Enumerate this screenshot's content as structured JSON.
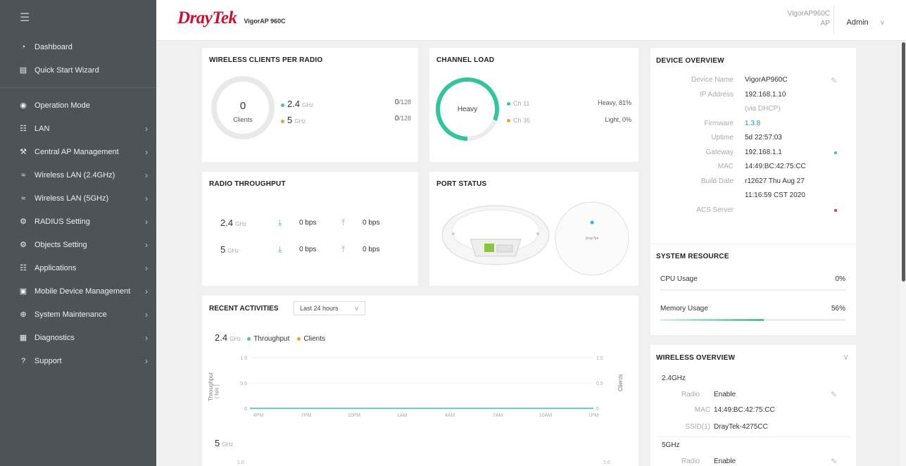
{
  "sidebar": {
    "items": [
      {
        "label": "Dashboard",
        "icon": "dashboard-icon",
        "has_children": false
      },
      {
        "label": "Quick Start Wizard",
        "icon": "wizard-icon",
        "has_children": false
      },
      {
        "label": "Operation Mode",
        "icon": "operation-mode-icon",
        "has_children": false
      },
      {
        "label": "LAN",
        "icon": "lan-icon",
        "has_children": true
      },
      {
        "label": "Central AP Management",
        "icon": "wrench-icon",
        "has_children": true
      },
      {
        "label": "Wireless LAN (2.4GHz)",
        "icon": "wifi-icon",
        "has_children": true
      },
      {
        "label": "Wireless LAN (5GHz)",
        "icon": "wifi-icon",
        "has_children": true
      },
      {
        "label": "RADIUS Setting",
        "icon": "gear-icon",
        "has_children": true
      },
      {
        "label": "Objects Setting",
        "icon": "gear-icon",
        "has_children": true
      },
      {
        "label": "Applications",
        "icon": "applications-icon",
        "has_children": true
      },
      {
        "label": "Mobile Device Management",
        "icon": "mobile-device-icon",
        "has_children": true
      },
      {
        "label": "System Maintenance",
        "icon": "globe-icon",
        "has_children": true
      },
      {
        "label": "Diagnostics",
        "icon": "diagnostics-icon",
        "has_children": true
      },
      {
        "label": "Support",
        "icon": "help-icon",
        "has_children": true
      }
    ]
  },
  "header": {
    "brand": "DrayTek",
    "model": "VigorAP 960C",
    "device_name": "VigorAP960C",
    "device_mode": "AP",
    "user": "Admin"
  },
  "clients": {
    "title": "WIRELESS CLIENTS PER RADIO",
    "count": "0",
    "count_label": "Clients",
    "radio1_band": "2.4",
    "radio1_unit": "GHz",
    "radio1_value": "0",
    "radio1_max": "/128",
    "radio2_band": "5",
    "radio2_unit": "GHz",
    "radio2_value": "0",
    "radio2_max": "/128"
  },
  "channel_load": {
    "title": "CHANNEL LOAD",
    "center": "Heavy",
    "ch1_label": "Ch 11",
    "ch1_value": "Heavy, 81%",
    "ch1_percent": 81,
    "ch2_label": "Ch 36",
    "ch2_value": "Light, 0%",
    "ch2_percent": 0
  },
  "throughput": {
    "title": "RADIO THROUGHPUT",
    "r1_band": "2.4",
    "r1_unit": "GHz",
    "r1_down": "0 bps",
    "r1_up": "0 bps",
    "r2_band": "5",
    "r2_unit": "GHz",
    "r2_down": "0 bps",
    "r2_up": "0 bps"
  },
  "port_status": {
    "title": "PORT STATUS",
    "device_logo": "DrayTek"
  },
  "activities": {
    "title": "RECENT ACTIVITIES",
    "range": "Last 24 hours",
    "band1": "2.4",
    "band1_unit": "GHz",
    "legend_throughput": "Throughput",
    "legend_clients": "Clients",
    "y_left_label": "Throughput",
    "y_left_unit": "( bps )",
    "y_right_label": "Clients",
    "band2": "5",
    "band2_unit": "GHz",
    "band2_tick_left": "1.0",
    "band2_tick_right": "1.0"
  },
  "chart_data": {
    "type": "line",
    "title": "",
    "x": [
      "4PM",
      "7PM",
      "10PM",
      "1AM",
      "4AM",
      "7AM",
      "10AM",
      "1PM"
    ],
    "ylim": [
      0,
      1.0
    ],
    "yticks": [
      "1.0",
      "0.5",
      "0"
    ],
    "y2ticks": [
      "1.0",
      "0.5",
      "0"
    ],
    "ylabel": "Throughput",
    "y2label": "Clients",
    "series": [
      {
        "name": "Throughput",
        "values": [
          0,
          0,
          0,
          0,
          0,
          0,
          0,
          0
        ],
        "color": "#3fc2a3"
      },
      {
        "name": "Clients",
        "values": [
          0,
          0,
          0,
          0,
          0,
          0,
          0,
          0
        ],
        "color": "#f0a030"
      }
    ]
  },
  "device_overview": {
    "title": "DEVICE OVERVIEW",
    "rows": [
      {
        "key": "Device Name",
        "value": "VigorAP960C"
      },
      {
        "key": "IP Address",
        "value": "192.168.1.10"
      },
      {
        "key": "",
        "value": "(via DHCP)"
      },
      {
        "key": "Firmware",
        "value": "1.3.8"
      },
      {
        "key": "Uptime",
        "value": "5d 22:57:03"
      },
      {
        "key": "Gateway",
        "value": "192.168.1.1"
      },
      {
        "key": "MAC",
        "value": "14:49:BC:42:75:CC"
      },
      {
        "key": "Build Date",
        "value": "r12627 Thu Aug 27"
      },
      {
        "key": "",
        "value": "11:16:59 CST 2020"
      },
      {
        "key": "ACS Server",
        "value": ""
      }
    ],
    "gateway_status_color": "#3fc2a3",
    "acs_status_color": "#e8344c"
  },
  "system_resource": {
    "title": "SYSTEM RESOURCE",
    "cpu_label": "CPU Usage",
    "cpu_value": "0%",
    "cpu_percent": 0,
    "mem_label": "Memory Usage",
    "mem_value": "56%",
    "mem_percent": 56
  },
  "wireless_overview": {
    "title": "WIRELESS OVERVIEW",
    "band1": "2.4GHz",
    "b1_radio_key": "Radio",
    "b1_radio": "Enable",
    "b1_mac_key": "MAC",
    "b1_mac": "14:49:BC:42:75:CC",
    "b1_ssid_key": "SSID(1)",
    "b1_ssid": "DrayTek-4275CC",
    "band2": "5GHz",
    "b2_radio_key": "Radio",
    "b2_radio": "Enable"
  }
}
